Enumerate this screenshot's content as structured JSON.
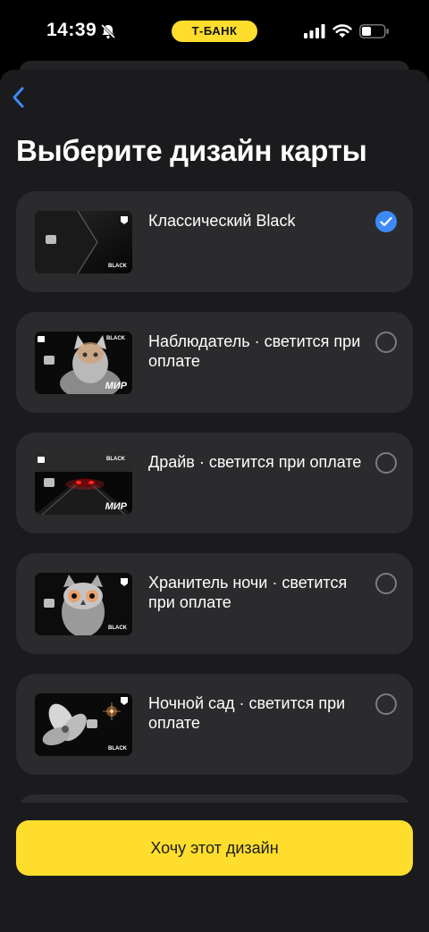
{
  "status_bar": {
    "time": "14:39",
    "bank_pill": "Т-БАНК"
  },
  "header": {
    "title": "Выберите дизайн карты"
  },
  "options": [
    {
      "label": "Классический Black",
      "selected": true,
      "thumb": "classic-black"
    },
    {
      "label": "Наблюдатель · светится при оплате",
      "selected": false,
      "thumb": "cat"
    },
    {
      "label": "Драйв · светится при оплате",
      "selected": false,
      "thumb": "car"
    },
    {
      "label": "Хранитель ночи · светится при оплате",
      "selected": false,
      "thumb": "owl"
    },
    {
      "label": "Ночной сад · светится при оплате",
      "selected": false,
      "thumb": "flower"
    }
  ],
  "card_text": {
    "black": "BLACK",
    "mir": "МИР"
  },
  "cta": {
    "label": "Хочу этот дизайн"
  },
  "colors": {
    "accent_yellow": "#ffdd2d",
    "check_blue": "#3d8af7",
    "sheet_bg": "#1b1b1d",
    "row_bg": "#2b2b2e"
  }
}
